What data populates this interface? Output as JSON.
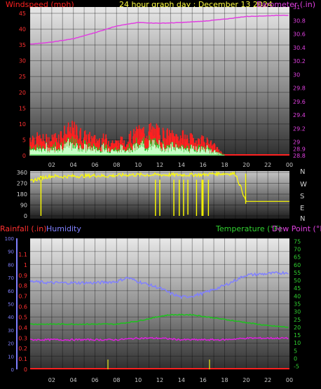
{
  "header": {
    "wind_label": "Windspeed (mph)",
    "title": "24 hour graph day : December 13 2024",
    "baro_label": "Barometer (.in)",
    "rain_label": "Rainfall (.in)",
    "hum_label": "Humidity",
    "temp_label": "Temperature (°F)",
    "dew_label": "Dew Point (°F)"
  },
  "colors": {
    "wind": "#ff2020",
    "gust_green": "#20c020",
    "wind_avg": "#c8ffc8",
    "baro": "#e040e0",
    "dir": "#ffff00",
    "rain": "#ff2020",
    "humidity": "#8080ff",
    "temp": "#20c020",
    "dew": "#e020e0",
    "rain_axis": "#ff3030",
    "hum_axis": "#8080ff",
    "temp_axis": "#30d030",
    "baro_axis": "#e040e0",
    "dir_axis": "#ffff40"
  },
  "x_ticks": [
    "02",
    "04",
    "06",
    "08",
    "10",
    "12",
    "14",
    "16",
    "18",
    "20",
    "22",
    "00"
  ],
  "chart_data": [
    {
      "type": "line",
      "title": "24 hour graph day : December 13 2024",
      "xlabel": "",
      "series": [
        {
          "name": "Windspeed (mph)",
          "axis": "left",
          "x": [
            0,
            1,
            2,
            3,
            4,
            5,
            6,
            7,
            8,
            9,
            10,
            11,
            12,
            13,
            14,
            15,
            16,
            17,
            18
          ],
          "values": [
            6,
            5,
            5,
            7,
            8,
            6,
            5,
            5,
            4,
            5,
            7,
            8,
            7,
            6,
            6,
            5,
            5,
            3,
            0
          ]
        },
        {
          "name": "Barometer (.in)",
          "axis": "right",
          "x": [
            0,
            2,
            4,
            6,
            8,
            10,
            12,
            14,
            16,
            18,
            20,
            22,
            23.5,
            24
          ],
          "values": [
            30.45,
            30.48,
            30.53,
            30.62,
            30.72,
            30.77,
            30.76,
            30.77,
            30.79,
            30.82,
            30.86,
            30.87,
            30.88,
            30.87
          ]
        }
      ],
      "y_left": {
        "ticks": [
          "0",
          "5",
          "10",
          "15",
          "20",
          "25",
          "30",
          "35",
          "40",
          "45"
        ],
        "ylim": [
          0,
          47
        ]
      },
      "y_right": {
        "ticks": [
          "28.8",
          "28.9",
          "29",
          "29.2",
          "29.4",
          "29.6",
          "29.8",
          "30",
          "30.2",
          "30.4",
          "30.6",
          "30.8",
          "31"
        ],
        "ylim": [
          28.8,
          31.0
        ]
      }
    },
    {
      "type": "line",
      "title": "",
      "series": [
        {
          "name": "Wind direction",
          "x": [
            0,
            1,
            2,
            3,
            4,
            5,
            6,
            7,
            8,
            9,
            10,
            11,
            12,
            13,
            14,
            15,
            16,
            17,
            18,
            19,
            20,
            24
          ],
          "values": [
            285,
            315,
            330,
            325,
            330,
            330,
            335,
            330,
            335,
            340,
            340,
            340,
            340,
            340,
            340,
            340,
            340,
            350,
            350,
            350,
            120,
            120
          ]
        }
      ],
      "y_left": {
        "ticks": [
          "0",
          "90",
          "180",
          "270",
          "360"
        ],
        "ylim": [
          0,
          360
        ]
      },
      "y_right": {
        "ticks": [
          "N",
          "W",
          "S",
          "E",
          "N"
        ]
      }
    },
    {
      "type": "line",
      "title": "",
      "series": [
        {
          "name": "Rainfall (.in)",
          "axis": "rain",
          "x": [
            0,
            24
          ],
          "values": [
            0,
            0
          ]
        },
        {
          "name": "Humidity",
          "axis": "humidity",
          "x": [
            0,
            2,
            4,
            6,
            8,
            9,
            10,
            12,
            13,
            14,
            15,
            16,
            18,
            20,
            22,
            24
          ],
          "values": [
            67,
            66,
            66,
            66,
            67,
            70,
            67,
            62,
            58,
            55,
            56,
            58,
            64,
            72,
            73,
            74
          ]
        },
        {
          "name": "Temperature (°F)",
          "axis": "temp",
          "x": [
            0,
            2,
            4,
            6,
            8,
            10,
            12,
            13,
            14,
            15,
            16,
            18,
            20,
            22,
            24
          ],
          "values": [
            22,
            22,
            22,
            22,
            22,
            24,
            27,
            28,
            28,
            28,
            27,
            25,
            23,
            21,
            20
          ]
        },
        {
          "name": "Dew Point (°F)",
          "axis": "temp",
          "x": [
            0,
            2,
            4,
            6,
            8,
            10,
            12,
            14,
            16,
            18,
            20,
            22,
            24
          ],
          "values": [
            12,
            12,
            12,
            12,
            12,
            13,
            13,
            12,
            12,
            12,
            13,
            13,
            13
          ]
        }
      ],
      "y_rain": {
        "ticks": [
          "0",
          "0.1",
          "0.2",
          "0.3",
          "0.4",
          "0.5",
          "0.6",
          "0.7",
          "0.8",
          "0.9",
          "1",
          "1.1"
        ],
        "ylim": [
          0,
          1.2
        ]
      },
      "y_humidity": {
        "ticks": [
          "0",
          "10",
          "20",
          "30",
          "40",
          "50",
          "60",
          "70",
          "80",
          "90",
          "100"
        ],
        "ylim": [
          0,
          100
        ]
      },
      "y_temp": {
        "ticks": [
          "-5",
          "0",
          "5",
          "10",
          "15",
          "20",
          "25",
          "30",
          "35",
          "40",
          "45",
          "50",
          "55",
          "60",
          "65",
          "70",
          "75"
        ],
        "ylim": [
          -7,
          77
        ]
      }
    }
  ]
}
